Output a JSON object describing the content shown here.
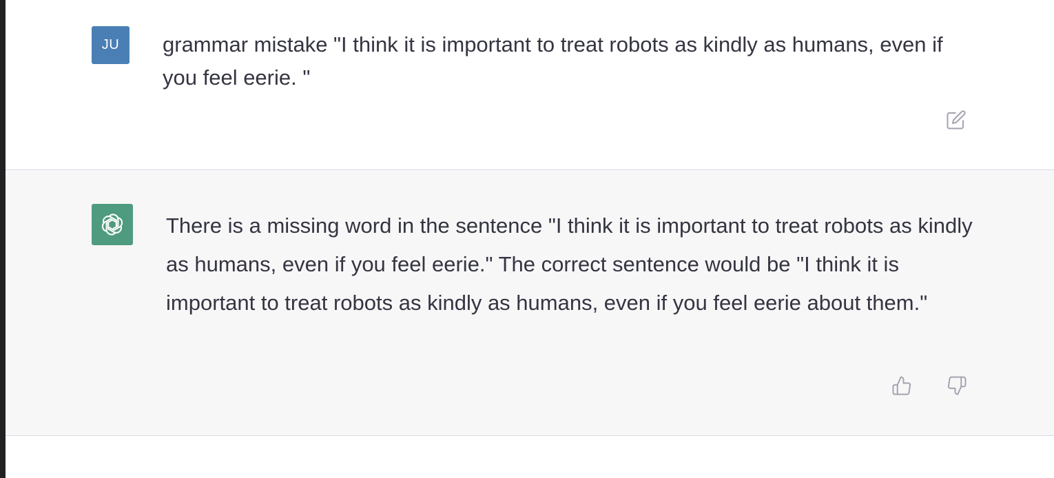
{
  "conversation": {
    "user_message": {
      "avatar_initials": "JU",
      "avatar_color": "#4a7fb5",
      "text": "grammar mistake \"I think it is important to treat robots as kindly as humans, even if you feel eerie. \"",
      "edit_icon": "edit-icon"
    },
    "assistant_message": {
      "avatar_icon": "openai-logo-icon",
      "avatar_color": "#4f9b80",
      "text": "There is a missing word in the sentence \"I think it is important to treat robots as kindly as humans, even if you feel eerie.\" The correct sentence would be \"I think it is important to treat robots as kindly as humans, even if you feel eerie about them.\"",
      "thumbs_up_icon": "thumbs-up-icon",
      "thumbs_down_icon": "thumbs-down-icon"
    }
  }
}
